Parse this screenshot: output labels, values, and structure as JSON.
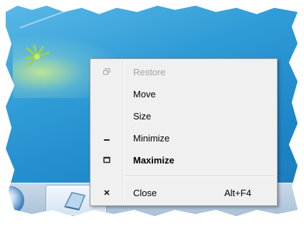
{
  "system_menu": {
    "items": [
      {
        "label": "Restore",
        "icon": "restore-icon",
        "disabled": true
      },
      {
        "label": "Move"
      },
      {
        "label": "Size"
      },
      {
        "label": "Minimize",
        "icon": "minimize-icon"
      },
      {
        "label": "Maximize",
        "icon": "maximize-icon",
        "default": true
      },
      {
        "label": "Close",
        "icon": "close-icon",
        "shortcut": "Alt+F4"
      }
    ]
  },
  "taskbar": {
    "start_icon": "windows-orb-icon",
    "button_icon": "notepad-app-icon"
  },
  "colors": {
    "menu_bg": "#f0f0f0",
    "disabled_text": "#a0a0a0",
    "desktop": "#2f9bd6"
  }
}
